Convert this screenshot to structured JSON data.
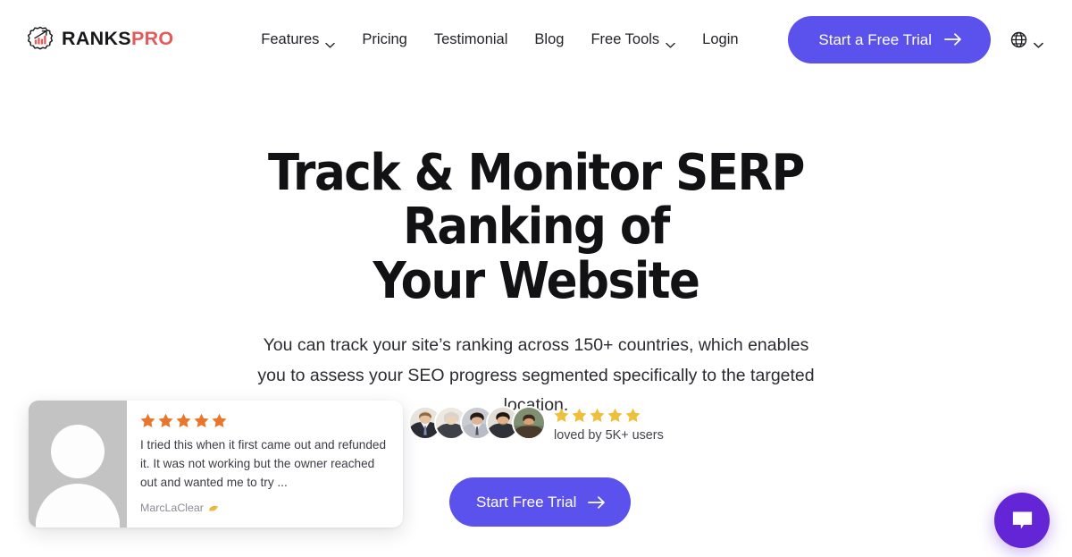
{
  "brand": {
    "name_primary": "RANKS",
    "name_accent": "PRO",
    "logo_icon": "gear-chart-icon",
    "accent_color": "#e25c5c"
  },
  "nav": {
    "items": [
      {
        "label": "Features",
        "has_dropdown": true,
        "icon": "chevron-down-icon"
      },
      {
        "label": "Pricing",
        "has_dropdown": false,
        "icon": ""
      },
      {
        "label": "Testimonial",
        "has_dropdown": false,
        "icon": ""
      },
      {
        "label": "Blog",
        "has_dropdown": false,
        "icon": ""
      },
      {
        "label": "Free Tools",
        "has_dropdown": true,
        "icon": "chevron-down-icon"
      },
      {
        "label": "Login",
        "has_dropdown": false,
        "icon": ""
      }
    ]
  },
  "header_cta": {
    "label": "Start a Free Trial",
    "icon": "arrow-right-icon",
    "color": "#5b51ec"
  },
  "language_switcher": {
    "icon": "globe-icon",
    "chevron": "chevron-down-icon"
  },
  "hero": {
    "title_line1": "Track & Monitor SERP Ranking of",
    "title_line2": "Your Website",
    "subtitle": "You can track your site’s ranking across 150+ countries, which enables you to assess your SEO progress segmented specifically to the targeted location.",
    "cta": {
      "label": "Start Free Trial",
      "icon": "arrow-right-icon",
      "color": "#5b51ec"
    }
  },
  "testimonial": {
    "avatar_icon": "person-placeholder-icon",
    "rating": 5,
    "star_color": "#e8762c",
    "quote": "I tried this when it first came out and refunded it. It was not working but the owner reached out and wanted me to try ...",
    "author": "MarcLaClear",
    "author_badge_icon": "verified-badge-icon"
  },
  "social_proof": {
    "avatar_count": 5,
    "avatars": [
      {
        "alt": "user-avatar-1"
      },
      {
        "alt": "user-avatar-2"
      },
      {
        "alt": "user-avatar-3"
      },
      {
        "alt": "user-avatar-4"
      },
      {
        "alt": "user-avatar-5"
      }
    ],
    "rating": 5,
    "star_color": "#efbe3d",
    "label": "loved by 5K+ users"
  },
  "chat_widget": {
    "icon": "chat-bubble-icon",
    "color": "#6425d6"
  }
}
